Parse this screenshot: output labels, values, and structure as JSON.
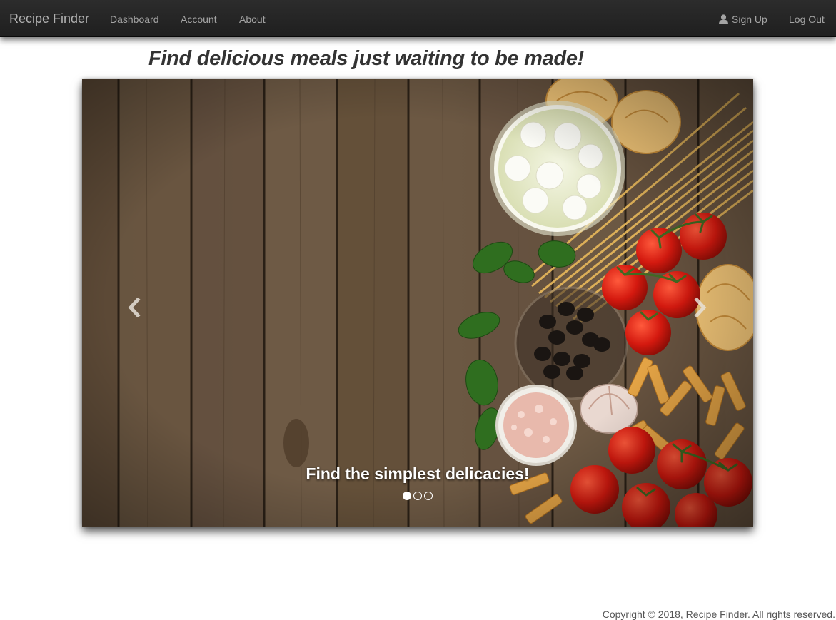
{
  "navbar": {
    "brand": "Recipe Finder",
    "links": [
      "Dashboard",
      "Account",
      "About"
    ],
    "signup": "Sign Up",
    "logout": "Log Out"
  },
  "headline": "Find delicious meals just waiting to be made!",
  "carousel": {
    "caption": "Find the simplest delicacies!",
    "slide_count": 3,
    "active_index": 0
  },
  "footer": {
    "copyright": "Copyright © 2018, Recipe Finder. All rights reserved."
  },
  "icons": {
    "signup": "user-icon",
    "prev": "chevron-left-icon",
    "next": "chevron-right-icon"
  },
  "colors": {
    "navbar_bg": "#222222",
    "nav_text": "#9d9d9d",
    "headline": "#333333",
    "caption": "#ffffff"
  }
}
